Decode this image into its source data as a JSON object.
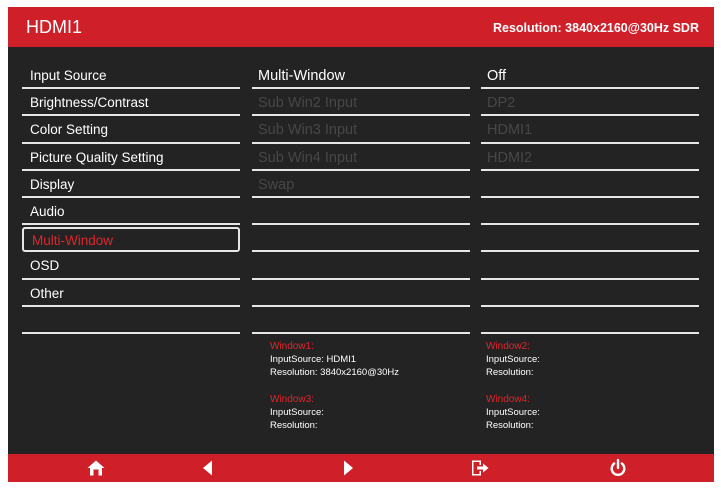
{
  "header": {
    "source": "HDMI1",
    "resolution": "Resolution: 3840x2160@30Hz SDR"
  },
  "menu": {
    "items": [
      {
        "label": "Input Source"
      },
      {
        "label": "Brightness/Contrast"
      },
      {
        "label": "Color Setting"
      },
      {
        "label": "Picture Quality Setting"
      },
      {
        "label": "Display"
      },
      {
        "label": "Audio"
      },
      {
        "label": "Multi-Window",
        "selected": true
      },
      {
        "label": "OSD"
      },
      {
        "label": "Other"
      }
    ]
  },
  "submenu": {
    "items": [
      {
        "label": "Multi-Window",
        "enabled": true
      },
      {
        "label": "Sub Win2 Input",
        "enabled": false
      },
      {
        "label": "Sub Win3 Input",
        "enabled": false
      },
      {
        "label": "Sub Win4 Input",
        "enabled": false
      },
      {
        "label": "Swap",
        "enabled": false
      }
    ]
  },
  "values": {
    "items": [
      {
        "label": "Off",
        "enabled": true
      },
      {
        "label": "DP2",
        "enabled": false
      },
      {
        "label": "HDMI1",
        "enabled": false
      },
      {
        "label": "HDMI2",
        "enabled": false
      }
    ]
  },
  "windows": {
    "w1": {
      "title": "Window1:",
      "source_label": "InputSource:",
      "source_value": "HDMI1",
      "res_label": "Resolution:",
      "res_value": "3840x2160@30Hz"
    },
    "w2": {
      "title": "Window2:",
      "source_label": "InputSource:",
      "source_value": "",
      "res_label": "Resolution:",
      "res_value": ""
    },
    "w3": {
      "title": "Window3:",
      "source_label": "InputSource:",
      "source_value": "",
      "res_label": "Resolution:",
      "res_value": ""
    },
    "w4": {
      "title": "Window4:",
      "source_label": "InputSource:",
      "source_value": "",
      "res_label": "Resolution:",
      "res_value": ""
    }
  },
  "nav": {
    "icons": [
      "home-icon",
      "left-arrow-icon",
      "right-arrow-icon",
      "exit-icon",
      "power-icon"
    ]
  },
  "colors": {
    "accent": "#cf1f29",
    "panel": "#232323",
    "selected_text": "#e0252c",
    "disabled_text": "#474747"
  }
}
